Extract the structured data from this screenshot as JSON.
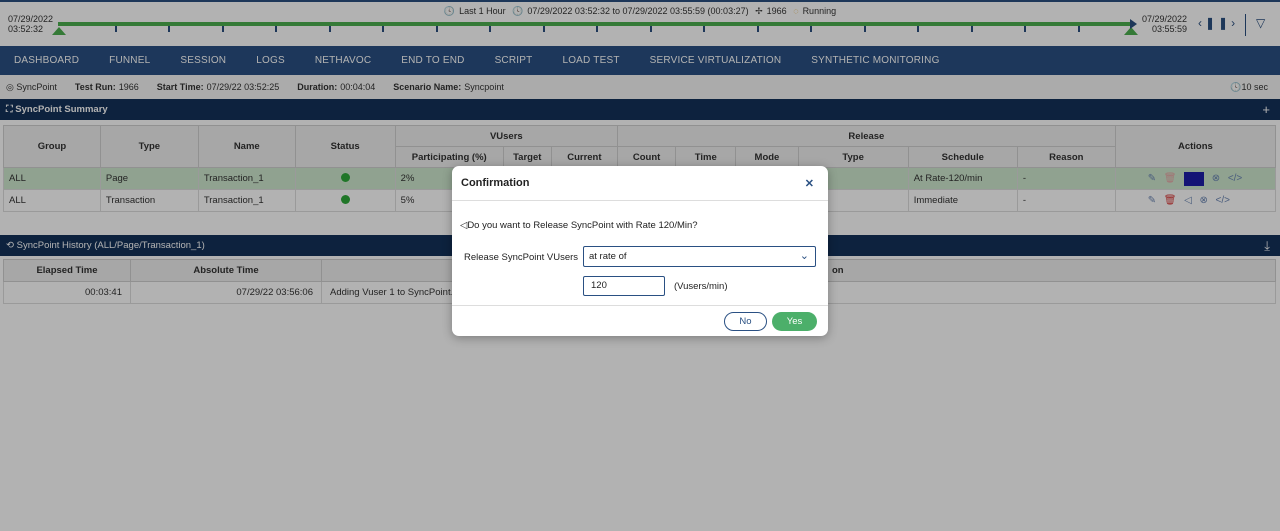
{
  "timeline": {
    "range_label": "Last 1 Hour",
    "range_detail": "07/29/2022 03:52:32 to 07/29/2022 03:55:59 (00:03:27)",
    "test_run": "1966",
    "status": "Running",
    "start_date": "07/29/2022",
    "start_time": "03:52:32",
    "end_date": "07/29/2022",
    "end_time": "03:55:59"
  },
  "nav": [
    "DASHBOARD",
    "FUNNEL",
    "SESSION",
    "LOGS",
    "NETHAVOC",
    "END TO END",
    "SCRIPT",
    "LOAD TEST",
    "SERVICE VIRTUALIZATION",
    "SYNTHETIC MONITORING"
  ],
  "infobar": {
    "page": "SyncPoint",
    "test_run_label": "Test Run:",
    "test_run": "1966",
    "start_label": "Start Time:",
    "start": "07/29/22 03:52:25",
    "duration_label": "Duration:",
    "duration": "00:04:04",
    "scenario_label": "Scenario Name:",
    "scenario": "Syncpoint",
    "refresh": "10 sec"
  },
  "summary": {
    "title": "SyncPoint Summary",
    "headers": {
      "group": "Group",
      "type": "Type",
      "name": "Name",
      "status": "Status",
      "vusers": "VUsers",
      "participating": "Participating (%)",
      "target": "Target",
      "current": "Current",
      "release": "Release",
      "count": "Count",
      "time": "Time",
      "mode": "Mode",
      "rtype": "Type",
      "schedule": "Schedule",
      "reason": "Reason",
      "actions": "Actions"
    },
    "rows": [
      {
        "group": "ALL",
        "type": "Page",
        "name": "Transaction_1",
        "participating": "2%",
        "schedule": "At Rate-120/min",
        "reason": "-"
      },
      {
        "group": "ALL",
        "type": "Transaction",
        "name": "Transaction_1",
        "participating": "5%",
        "schedule": "Immediate",
        "reason": "-"
      }
    ]
  },
  "history": {
    "title": "SyncPoint History (ALL/Page/Transaction_1)",
    "headers": {
      "elapsed": "Elapsed Time",
      "absolute": "Absolute Time",
      "description": "on"
    },
    "rows": [
      {
        "elapsed": "00:03:41",
        "absolute": "07/29/22 03:56:06",
        "description": "Adding Vuser 1 to SyncPoint. S"
      }
    ]
  },
  "modal": {
    "title": "Confirmation",
    "question": "Do you want to Release SyncPoint with Rate 120/Min?",
    "release_label": "Release SyncPoint VUsers",
    "release_mode": "at rate of",
    "rate_value": "120",
    "rate_unit": "(Vusers/min)",
    "no_label": "No",
    "yes_label": "Yes"
  }
}
